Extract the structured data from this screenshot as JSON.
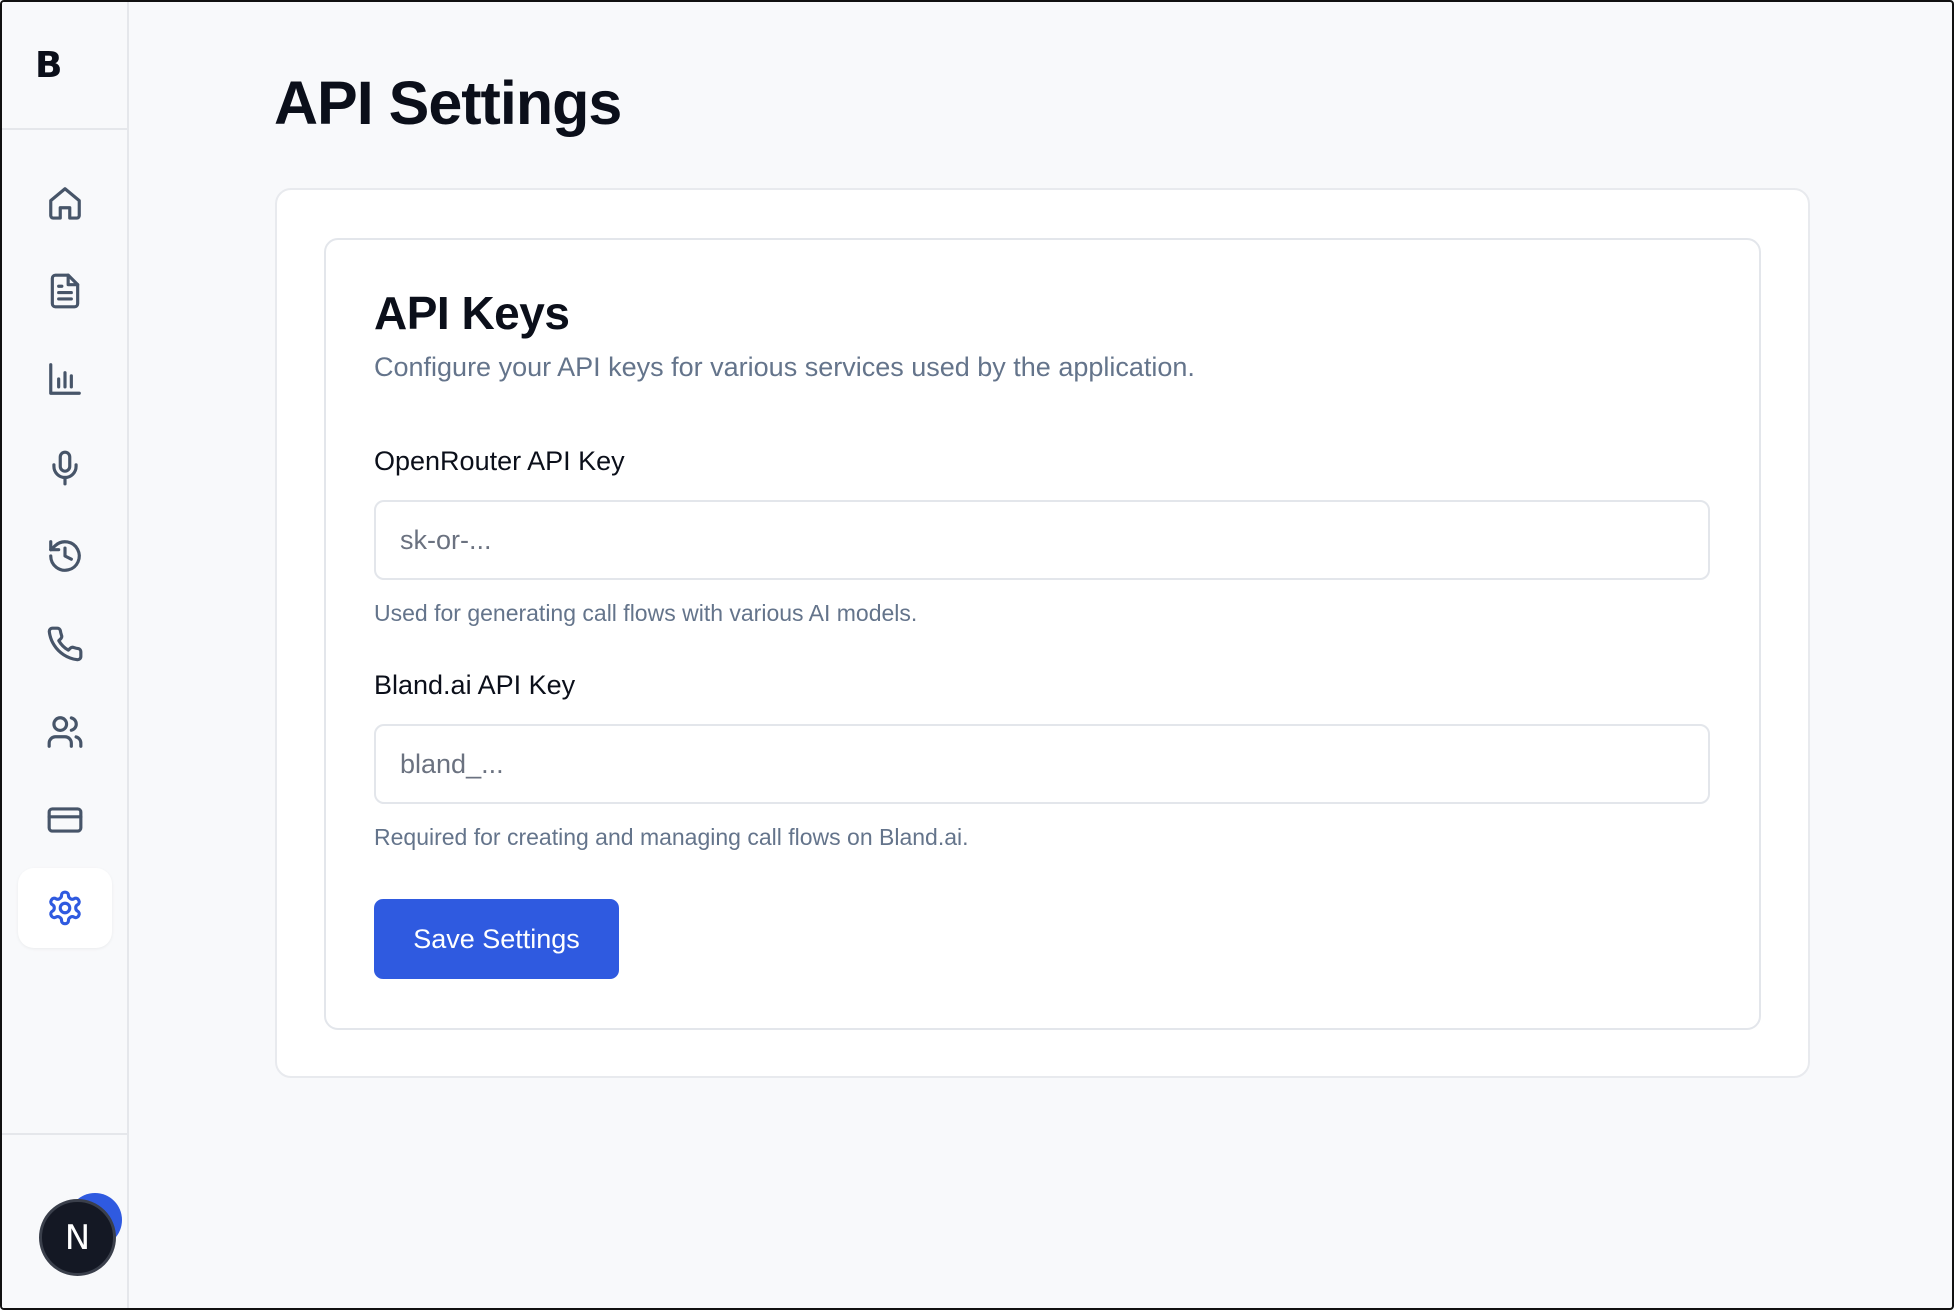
{
  "sidebar": {
    "logo": "B",
    "nav_items": [
      {
        "name": "home",
        "icon": "home-icon"
      },
      {
        "name": "documents",
        "icon": "file-text-icon"
      },
      {
        "name": "analytics",
        "icon": "bar-chart-icon"
      },
      {
        "name": "voice",
        "icon": "mic-icon"
      },
      {
        "name": "history",
        "icon": "history-icon"
      },
      {
        "name": "calls",
        "icon": "phone-icon"
      },
      {
        "name": "contacts",
        "icon": "users-icon"
      },
      {
        "name": "billing",
        "icon": "credit-card-icon"
      },
      {
        "name": "settings",
        "icon": "gear-icon",
        "active": true
      }
    ],
    "avatar_letter": "N"
  },
  "page": {
    "title": "API Settings"
  },
  "card": {
    "title": "API Keys",
    "description": "Configure your API keys for various services used by the application.",
    "fields": [
      {
        "label": "OpenRouter API Key",
        "placeholder": "sk-or-...",
        "value": "",
        "hint": "Used for generating call flows with various AI models."
      },
      {
        "label": "Bland.ai API Key",
        "placeholder": "bland_...",
        "value": "",
        "hint": "Required for creating and managing call flows on Bland.ai."
      }
    ],
    "save_label": "Save Settings"
  },
  "colors": {
    "accent": "#2f5ae0",
    "background": "#f8f9fb",
    "muted_text": "#64748b"
  }
}
